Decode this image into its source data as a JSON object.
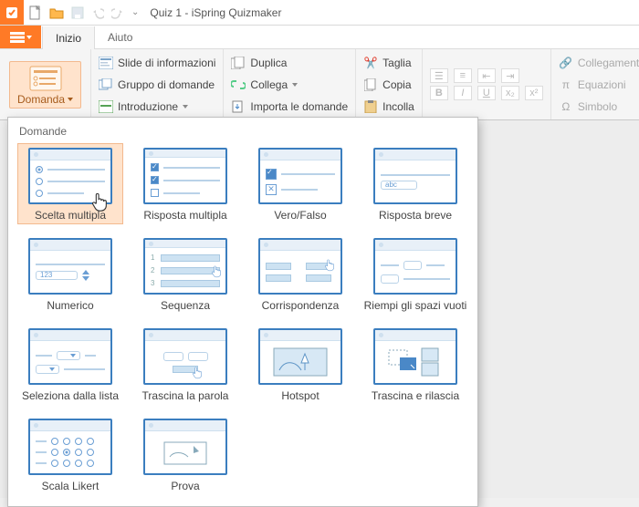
{
  "titlebar": {
    "title": "Quiz 1 - iSpring Quizmaker"
  },
  "tabs": {
    "file_caret": "▾",
    "inizio": "Inizio",
    "aiuto": "Aiuto"
  },
  "ribbon": {
    "domanda": "Domanda",
    "grp1": {
      "slide": "Slide di informazioni",
      "gruppo": "Gruppo di domande",
      "intro": "Introduzione"
    },
    "grp2": {
      "duplica": "Duplica",
      "collega": "Collega",
      "importa": "Importa le domande"
    },
    "grp3": {
      "taglia": "Taglia",
      "copia": "Copia",
      "incolla": "Incolla"
    },
    "grp5": {
      "link": "Collegamento ipert",
      "eq": "Equazioni",
      "sym": "Simbolo"
    }
  },
  "dropdown": {
    "section": "Domande",
    "items": [
      "Scelta multipla",
      "Risposta multipla",
      "Vero/Falso",
      "Risposta breve",
      "Numerico",
      "Sequenza",
      "Corrispondenza",
      "Riempi gli spazi vuoti",
      "Seleziona dalla lista",
      "Trascina la parola",
      "Hotspot",
      "Trascina e rilascia",
      "Scala Likert",
      "Prova"
    ]
  }
}
